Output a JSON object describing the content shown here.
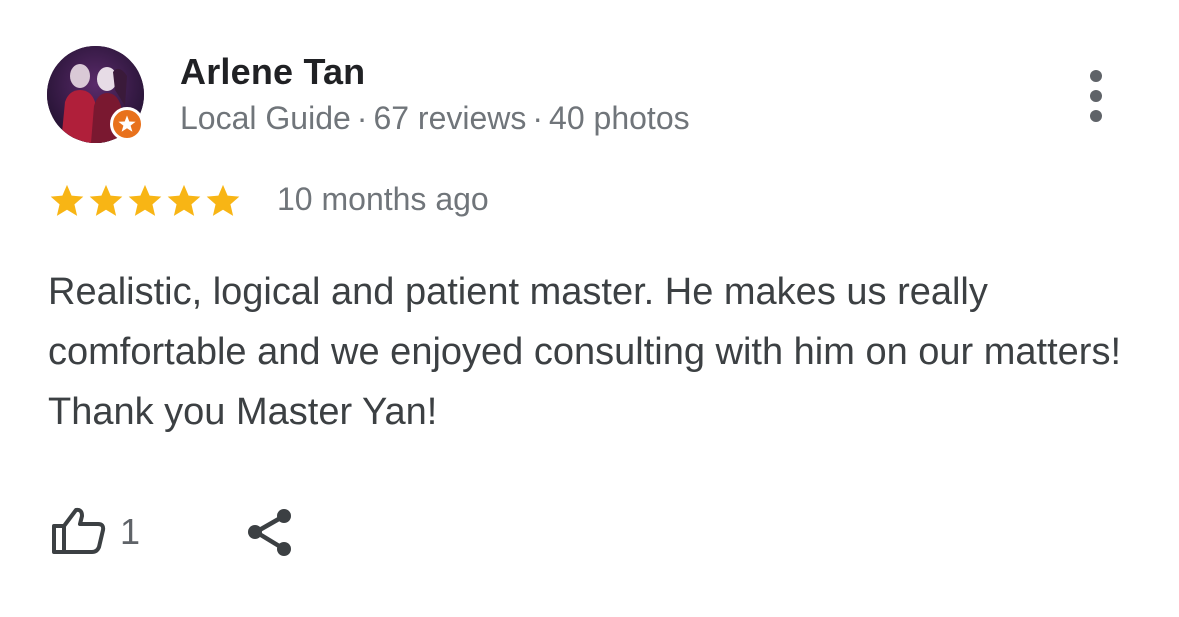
{
  "review": {
    "author": {
      "name": "Arlene Tan",
      "badge": "Local Guide",
      "separator": "·",
      "reviews": "67 reviews",
      "photos": "40 photos",
      "avatar_icon": "user-avatar-photo",
      "badge_icon": "local-guide-star-icon",
      "badge_color": "#e8711c"
    },
    "rating": 5,
    "rating_max": 5,
    "star_color": "#f8b515",
    "time": "10 months ago",
    "text": "Realistic, logical and patient master. He makes us really comfortable and we enjoyed consulting with him on our matters! Thank you Master Yan!",
    "actions": {
      "like_icon": "thumbs-up-icon",
      "like_count": "1",
      "share_icon": "share-icon",
      "more_icon": "more-vert-icon"
    }
  }
}
